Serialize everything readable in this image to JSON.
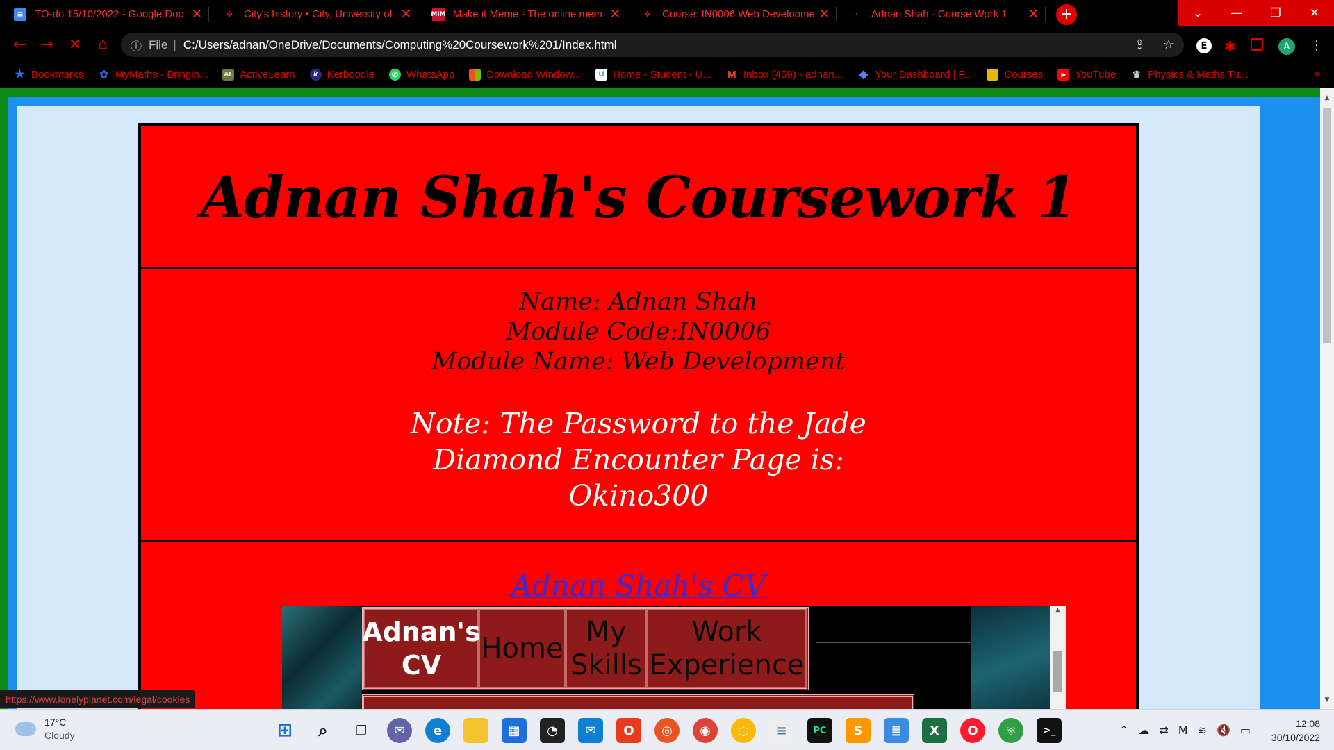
{
  "browser": {
    "tabs": [
      {
        "label": "TO-do 15/10/2022 - Google Doc",
        "icon": "google-docs-icon",
        "color": "#4285f4"
      },
      {
        "label": "City's history • City, University of",
        "icon": "city-university-icon",
        "color": "#c8102e"
      },
      {
        "label": "Make it Meme - The online mem",
        "icon": "mim-icon",
        "color": "#c8102e"
      },
      {
        "label": "Course: IN0006 Web Developme",
        "icon": "moodle-icon",
        "color": "#c8102e"
      },
      {
        "label": "Adnan Shah - Course Work 1",
        "icon": "loading-icon",
        "color": "#1a73e8"
      }
    ],
    "address": {
      "scheme_label": "File",
      "url": "C:/Users/adnan/OneDrive/Documents/Computing%20Coursework%201/Index.html"
    },
    "bookmarks": [
      {
        "label": "Bookmarks",
        "icon": "star-icon",
        "color": "#1a73e8"
      },
      {
        "label": "MyMaths - Bringin...",
        "icon": "mymaths-icon",
        "color": "#3b5bdb"
      },
      {
        "label": "ActiveLearn",
        "icon": "activelearn-icon",
        "color": "#6b7a3a",
        "text": "AL"
      },
      {
        "label": "Kerboodle",
        "icon": "kerboodle-icon",
        "color": "#2c2c7a",
        "text": "k"
      },
      {
        "label": "WhatsApp",
        "icon": "whatsapp-icon",
        "color": "#25d366"
      },
      {
        "label": "Download Window...",
        "icon": "microsoft-icon",
        "color": "#f25022"
      },
      {
        "label": "Home - Student - U...",
        "icon": "unifrog-icon",
        "color": "#1ca3ec",
        "text": "U"
      },
      {
        "label": "Inbox (459) - adnan...",
        "icon": "gmail-icon",
        "color": "#ea4335",
        "text": "M"
      },
      {
        "label": "Your Dashboard | F...",
        "icon": "diamond-icon",
        "color": "#5c7cfa"
      },
      {
        "label": "Courses",
        "icon": "courses-icon",
        "color": "#e6b800"
      },
      {
        "label": "YouTube",
        "icon": "youtube-icon",
        "color": "#ff0000"
      },
      {
        "label": "Physics & Maths Tu...",
        "icon": "pmt-icon",
        "color": "#444444"
      }
    ]
  },
  "page": {
    "title": "Adnan Shah's Coursework 1",
    "info_lines": [
      "Name: Adnan Shah",
      "Module Code:IN0006",
      "Module Name: Web Development"
    ],
    "note_lines": [
      "Note: The Password to the Jade",
      "Diamond Encounter Page is:",
      "Okino300"
    ],
    "cv_link": "Adnan Shah's CV",
    "cv_nav": {
      "brand": "Adnan's CV",
      "home": "Home",
      "skills": "My Skills",
      "work": "Work Experience"
    },
    "status_url": "https://www.lonelyplanet.com/legal/cookies"
  },
  "taskbar": {
    "weather_temp": "17°C",
    "weather_cond": "Cloudy",
    "time": "12:08",
    "date": "30/10/2022"
  },
  "colors": {
    "page_red": "#ff0000",
    "link": "#3a2bd8",
    "chrome_accent": "#e00000"
  }
}
